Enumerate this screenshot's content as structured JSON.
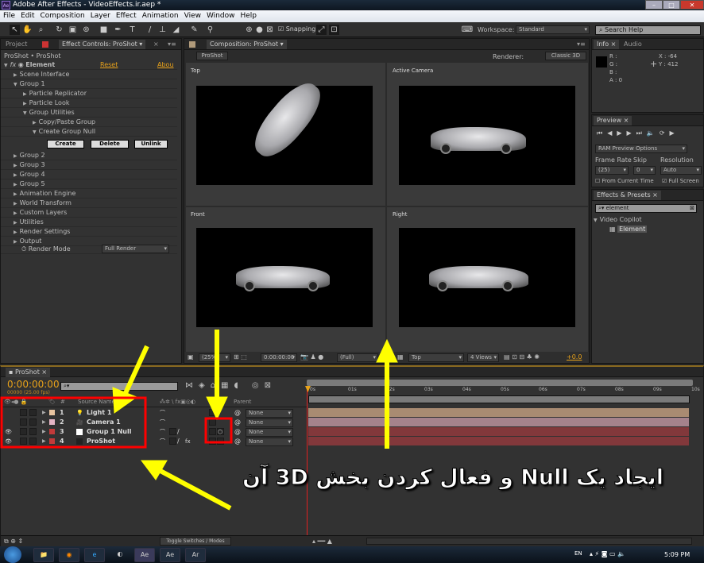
{
  "window": {
    "title": "Adobe After Effects - VideoEffects.ir.aep *",
    "logo": "Ae"
  },
  "menu": [
    "File",
    "Edit",
    "Composition",
    "Layer",
    "Effect",
    "Animation",
    "View",
    "Window",
    "Help"
  ],
  "toolbar": {
    "snapping": "Snapping",
    "workspace_label": "Workspace:",
    "workspace_value": "Standard",
    "search_placeholder": "Search Help"
  },
  "left_panel": {
    "tab_project": "Project",
    "tab_effect": "Effect Controls: ProShot",
    "breadcrumb": "ProShot • ProShot",
    "effect_name": "Element",
    "reset": "Reset",
    "about": "Abou",
    "items": [
      {
        "label": "Scene Interface",
        "indent": 1,
        "open": false
      },
      {
        "label": "Group 1",
        "indent": 1,
        "open": true
      },
      {
        "label": "Particle Replicator",
        "indent": 2,
        "open": false
      },
      {
        "label": "Particle Look",
        "indent": 2,
        "open": false
      },
      {
        "label": "Group Utilities",
        "indent": 2,
        "open": true
      },
      {
        "label": "Copy/Paste Group",
        "indent": 3,
        "open": false
      },
      {
        "label": "Create Group Null",
        "indent": 3,
        "open": true
      }
    ],
    "buttons": [
      "Create",
      "Delete",
      "Unlink"
    ],
    "items2": [
      "Group 2",
      "Group 3",
      "Group 4",
      "Group 5",
      "Animation Engine",
      "World Transform",
      "Custom Layers",
      "Utilities",
      "Render Settings",
      "Output"
    ],
    "render_mode_label": "Render Mode",
    "render_mode_value": "Full Render"
  },
  "composition": {
    "tab": "Composition: ProShot",
    "comp_button": "ProShot",
    "renderer_label": "Renderer:",
    "renderer_value": "Classic 3D",
    "views": [
      "Top",
      "Active Camera",
      "Front",
      "Right"
    ],
    "footer": {
      "zoom": "(25%)",
      "timecode": "0:00:00:00",
      "resolution": "(Full)",
      "view": "Top",
      "layout": "4 Views",
      "exposure": "+0.0"
    }
  },
  "info": {
    "tab_info": "Info",
    "tab_audio": "Audio",
    "r": "R :",
    "g": "G :",
    "b": "B :",
    "a": "A : 0",
    "x": "X : -64",
    "y": "Y : 412"
  },
  "preview": {
    "tab": "Preview",
    "ram_options": "RAM Preview Options",
    "frame_rate_label": "Frame Rate",
    "frame_rate": "(25)",
    "skip_label": "Skip",
    "skip": "0",
    "resolution_label": "Resolution",
    "resolution": "Auto",
    "from_current": "From Current Time",
    "full_screen": "Full Screen",
    "from_current_checked": false,
    "full_screen_checked": true
  },
  "effects_presets": {
    "tab": "Effects & Presets",
    "search": "element",
    "category": "Video Copilot",
    "item": "Element"
  },
  "timeline": {
    "tab": "ProShot",
    "timecode": "0:00:00:00",
    "fps": "00000 (25.00 fps)",
    "col_source": "Source Name",
    "col_num": "#",
    "col_parent": "Parent",
    "layers": [
      {
        "num": "1",
        "name": "Light 1",
        "color": "#e8c4a0",
        "bar": "#a98b72",
        "parent": "None"
      },
      {
        "num": "2",
        "name": "Camera 1",
        "color": "#e4b4c4",
        "bar": "#a5828c",
        "parent": "None"
      },
      {
        "num": "3",
        "name": "Group 1 Null",
        "color": "#c23a3a",
        "bar": "#82383b",
        "parent": "None"
      },
      {
        "num": "4",
        "name": "ProShot",
        "color": "#c23a3a",
        "bar": "#82383b",
        "parent": "None"
      }
    ],
    "ticks": [
      "0s",
      "01s",
      "02s",
      "03s",
      "04s",
      "05s",
      "06s",
      "07s",
      "08s",
      "09s",
      "10s"
    ],
    "toggle": "Toggle Switches / Modes"
  },
  "annotation": "ایجاد یک Null و فعال کردن بخش 3D آن",
  "taskbar": {
    "lang": "EN",
    "clock": "5:09 PM"
  },
  "colors": {
    "accent": "#e8a21a",
    "annotation_arrow": "#ffff00",
    "highlight_box": "#ff0000"
  }
}
